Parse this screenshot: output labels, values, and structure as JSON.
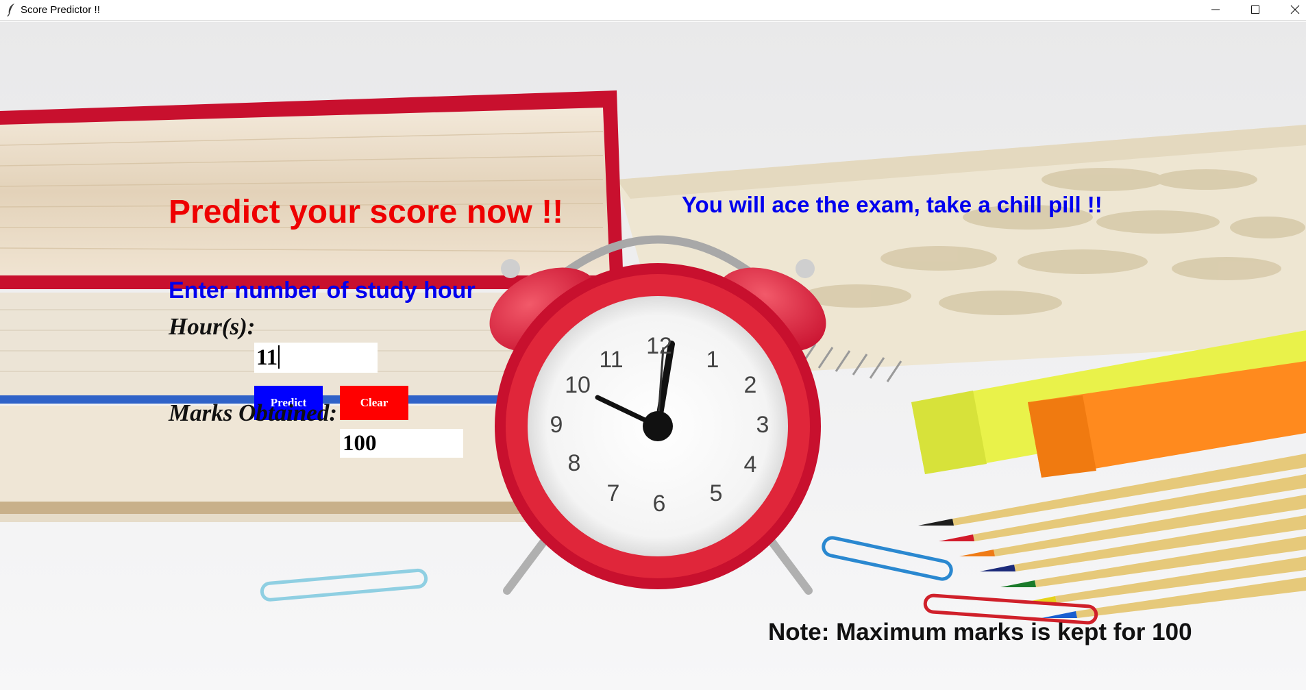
{
  "window": {
    "title": "Score Predictor !!",
    "controls": {
      "minimize": "minimize",
      "maximize": "maximize",
      "close": "close"
    }
  },
  "form": {
    "headline": "Predict your score now !!",
    "motto": "You will ace the exam, take a chill pill !!",
    "prompt": "Enter number of study hour",
    "hours_label": "Hour(s):",
    "hours_value": "11",
    "predict_label": "Predict",
    "clear_label": "Clear",
    "marks_label": "Marks Obtained:",
    "marks_value": "100",
    "note": "Note: Maximum marks is kept for 100"
  },
  "colors": {
    "headline": "#ee0000",
    "motto": "#0000ee",
    "predict_button": "#0000ff",
    "clear_button": "#ff0000"
  },
  "clock_numerals": [
    "12",
    "1",
    "2",
    "3",
    "4",
    "5",
    "6",
    "7",
    "8",
    "9",
    "10",
    "11"
  ]
}
